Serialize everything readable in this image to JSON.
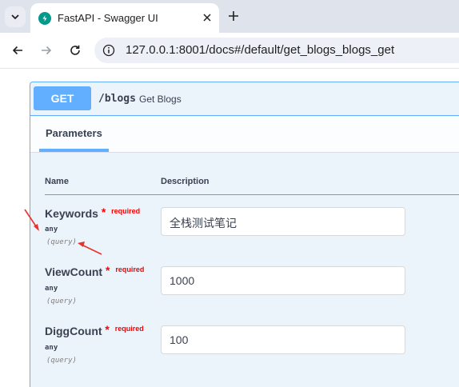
{
  "browser": {
    "tab_title": "FastAPI - Swagger UI",
    "url": "127.0.0.1:8001/docs#/default/get_blogs_blogs_get"
  },
  "operation": {
    "method": "GET",
    "path": "/blogs",
    "summary": "Get Blogs"
  },
  "parameters_tab": "Parameters",
  "table_headers": {
    "name": "Name",
    "description": "Description"
  },
  "parameters": [
    {
      "name": "Keywords",
      "required_star": "*",
      "required_label": "required",
      "type": "any",
      "in": "(query)",
      "value": "全栈测试笔记"
    },
    {
      "name": "ViewCount",
      "required_star": "*",
      "required_label": "required",
      "type": "any",
      "in": "(query)",
      "value": "1000"
    },
    {
      "name": "DiggCount",
      "required_star": "*",
      "required_label": "required",
      "type": "any",
      "in": "(query)",
      "value": "100"
    }
  ],
  "colors": {
    "get_blue": "#61affe",
    "required_red": "#ff0000",
    "annotation_red": "#e8322e"
  },
  "icons": [
    "tab-search-icon",
    "fastapi-favicon",
    "close-icon",
    "plus-icon",
    "back-arrow-icon",
    "forward-arrow-icon",
    "reload-icon",
    "site-info-icon"
  ]
}
